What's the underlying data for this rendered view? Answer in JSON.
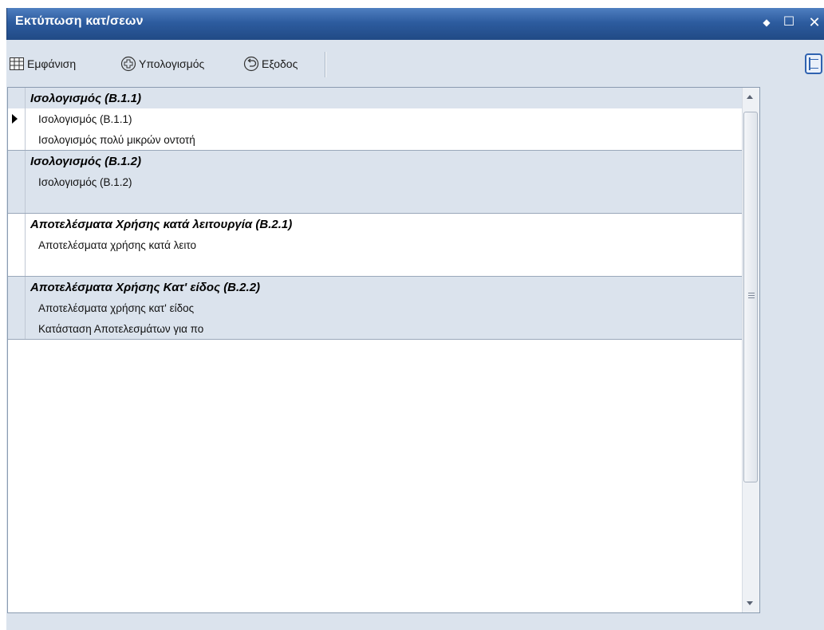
{
  "window": {
    "title": "Εκτύπωση κατ/σεων",
    "controls": {
      "pin": "◆",
      "maximize": "☐",
      "close": "✕"
    }
  },
  "toolbar": {
    "show_label": "Εμφάνιση",
    "calculate_label": "Υπολογισμός",
    "exit_label": "Εξοδος"
  },
  "groups": [
    {
      "header": "Ισολογισμός (Β.1.1)",
      "items": [
        "Ισολογισμός (Β.1.1)",
        "Ισολογισμός πολύ μικρών οντοτή"
      ],
      "selected_item": 0
    },
    {
      "header": "Ισολογισμός (Β.1.2)",
      "items": [
        "Ισολογισμός (Β.1.2)"
      ]
    },
    {
      "header": "Αποτελέσματα Χρήσης κατά λειτουργία (Β.2.1)",
      "items": [
        "Αποτελέσματα χρήσης κατά λειτο"
      ]
    },
    {
      "header": "Αποτελέσματα Χρήσης Κατ' είδος (Β.2.2)",
      "items": [
        "Αποτελέσματα χρήσης κατ' είδος",
        "Κατάσταση Αποτελεσμάτων για πο"
      ]
    }
  ],
  "colors": {
    "titlebar": "#2d5c9f",
    "group_shade": "#dbe3ed",
    "background": "#dbe3ed"
  }
}
